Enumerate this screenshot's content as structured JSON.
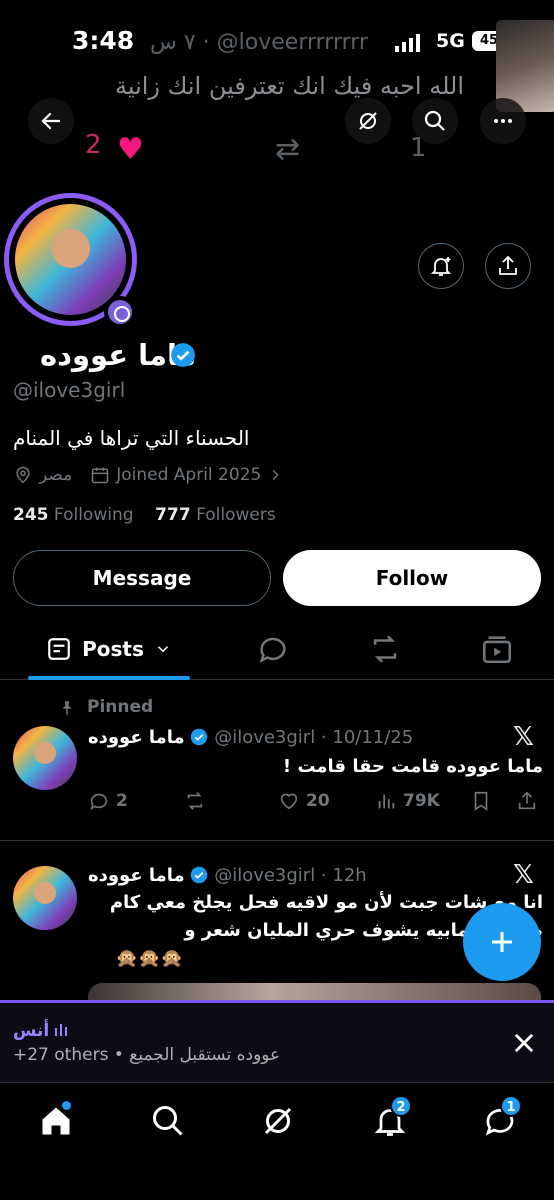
{
  "status_bar": {
    "time": "3:48",
    "network": "5G",
    "battery": "45"
  },
  "header_overlay": {
    "handle_ghost": "٧ س · @loveerrrrrrrr",
    "text_ghost": "الله احبه فيك انك تعترفين انك زانية",
    "likes_count": "2",
    "reply_count": "1"
  },
  "profile": {
    "name": "ماما عووده",
    "handle": "@ilove3girl",
    "bio": "الحسناء التي تراها في المنام",
    "location": "مصر",
    "joined": "Joined April 2025",
    "following_count": "245",
    "following_label": "Following",
    "followers_count": "777",
    "followers_label": "Followers",
    "message_label": "Message",
    "follow_label": "Follow"
  },
  "tabs": {
    "posts_label": "Posts"
  },
  "tweets": [
    {
      "pinned_label": "Pinned",
      "name": "ماما عووده",
      "handle_date": "@ilove3girl · 10/11/25",
      "text": "ماما عووده قامت حقا قامت !",
      "replies": "2",
      "likes": "20",
      "views": "79K"
    },
    {
      "name": "ماما عووده",
      "handle_date": "@ilove3girl · 12h",
      "text_line1": "انا مع شات جبت لأن مو لاقيه فحل يجلخ معي كام",
      "text_line2": "صوتي ( مابيه يشوف حري المليان شعر و",
      "text_line3": "🙊🙊🙊"
    }
  ],
  "space": {
    "host": "أنس ",
    "title": "+27 others • عووده تستقبل الجميع"
  },
  "bottom_nav": {
    "notifications_badge": "2",
    "messages_badge": "1"
  },
  "colors": {
    "accent": "#1d9bf0",
    "like": "#f91880",
    "space": "#7856ff"
  }
}
